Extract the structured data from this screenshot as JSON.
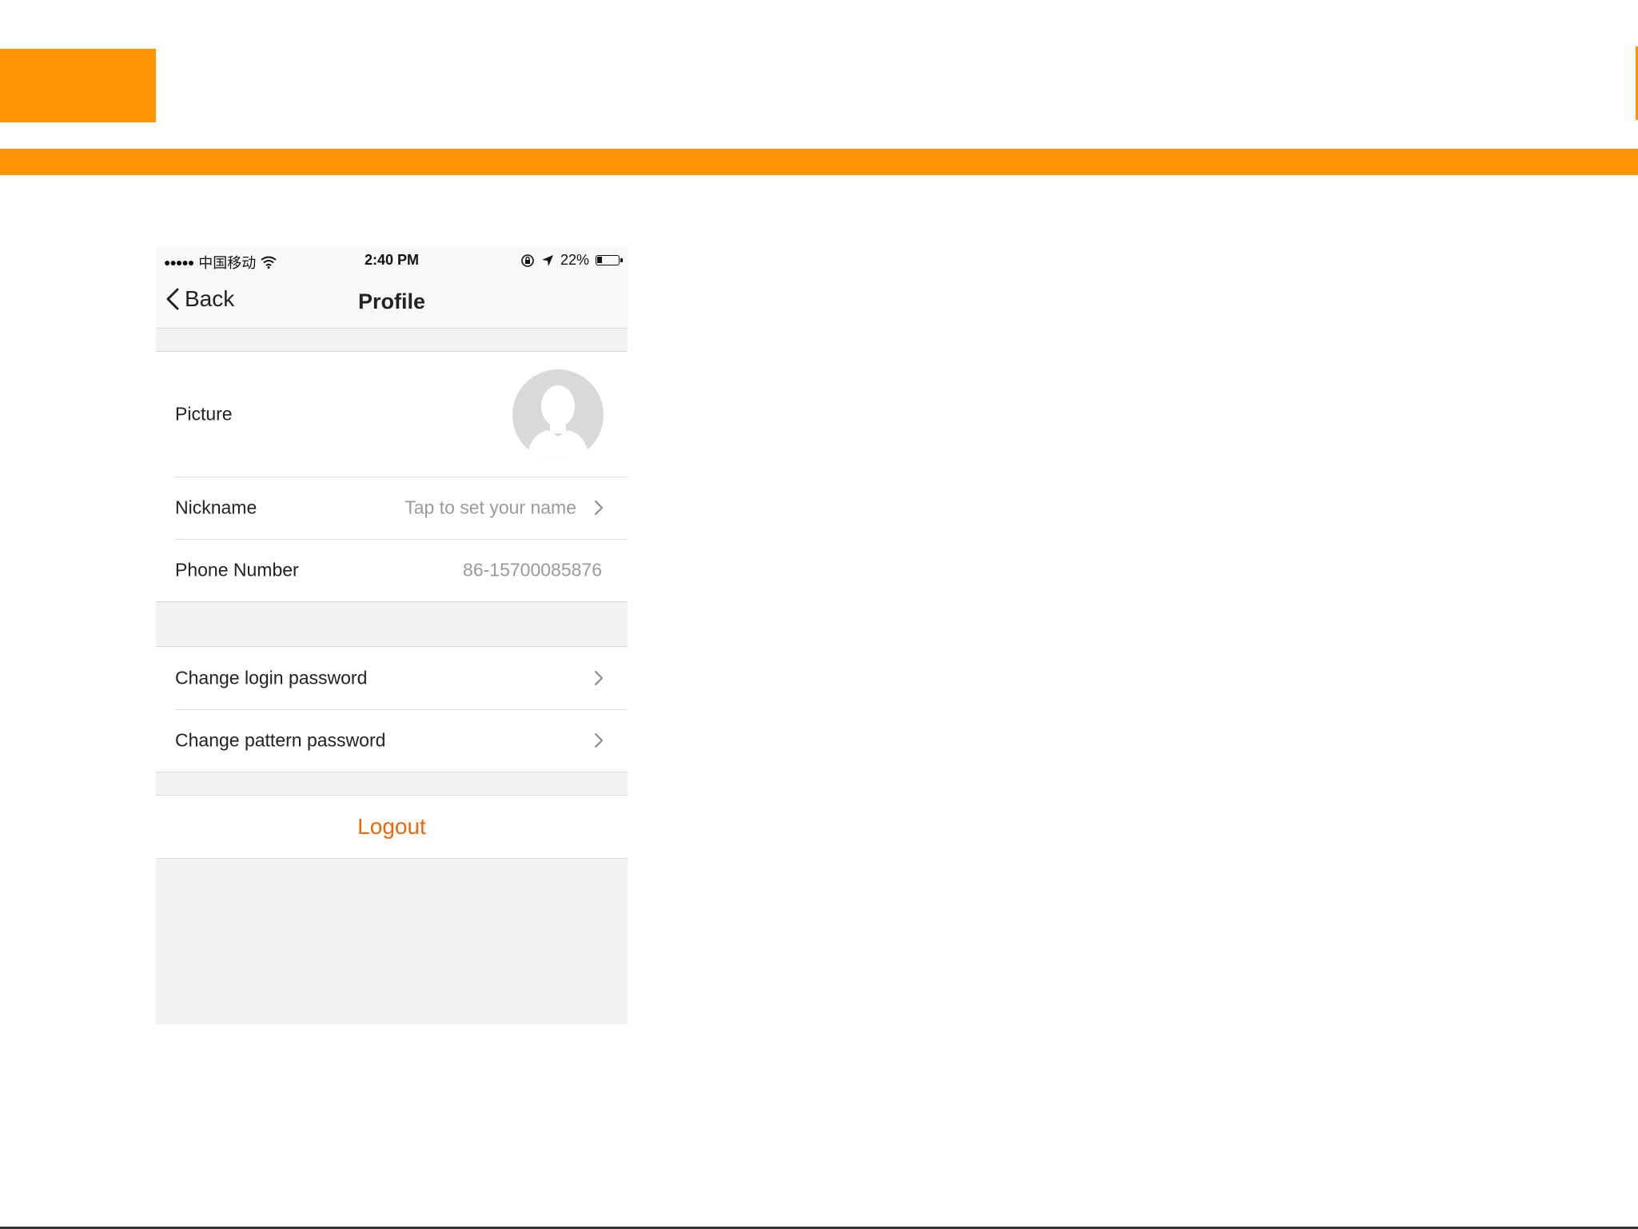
{
  "status_bar": {
    "signal_dots": "●●●●●",
    "carrier": "中国移动",
    "time": "2:40 PM",
    "battery_percent": "22%",
    "battery_level": 0.22,
    "icons": [
      "signal-dots-icon",
      "wifi-icon",
      "orientation-lock-icon",
      "location-arrow-icon",
      "battery-icon"
    ]
  },
  "navbar": {
    "back_label": "Back",
    "title": "Profile"
  },
  "profile": {
    "picture_label": "Picture",
    "nickname_label": "Nickname",
    "nickname_placeholder": "Tap to set your name",
    "phone_label": "Phone Number",
    "phone_value": "86-15700085876"
  },
  "security": {
    "change_login_password": "Change login password",
    "change_pattern_password": "Change pattern password"
  },
  "logout_label": "Logout",
  "colors": {
    "accent_orange": "#FF9506",
    "logout_red_orange": "#F0660A",
    "secondary_text": "#9a9a9a",
    "group_background": "#f2f2f2"
  }
}
